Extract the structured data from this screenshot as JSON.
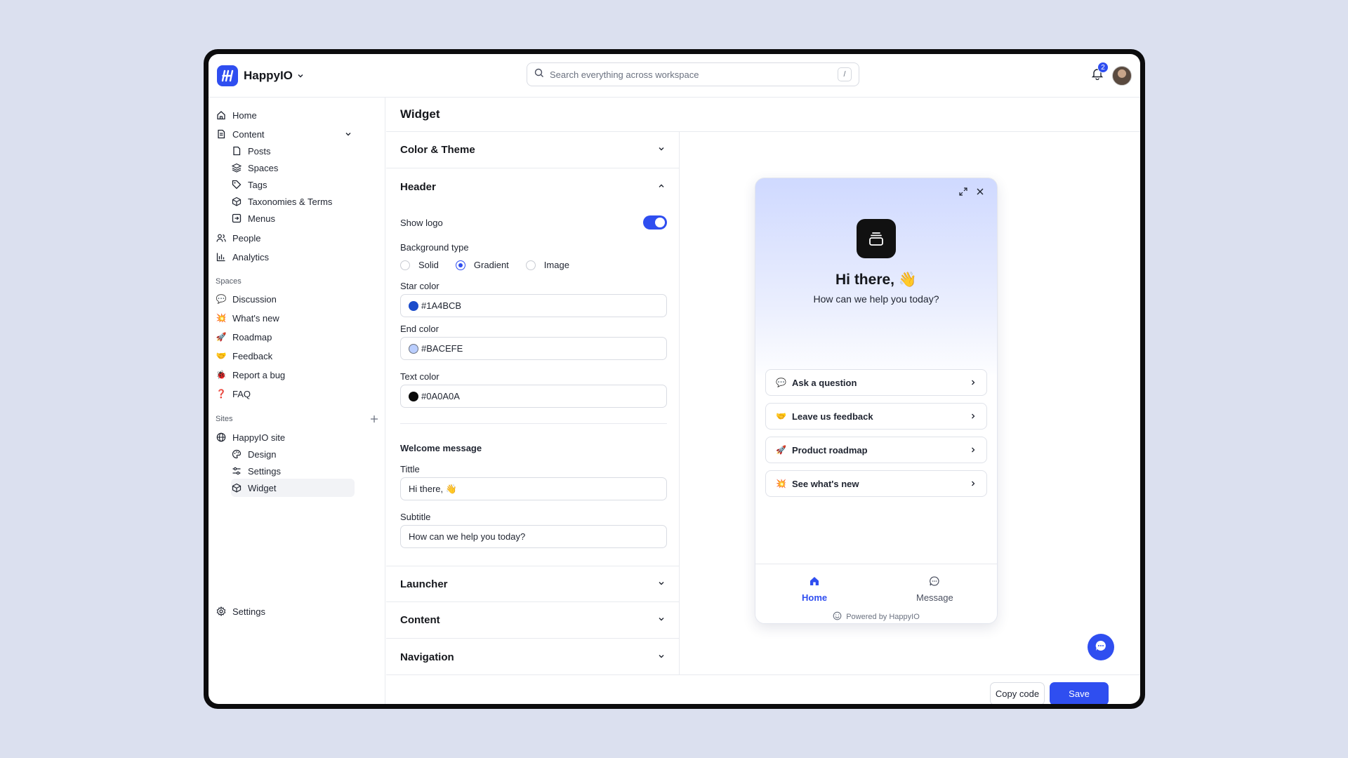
{
  "brand": {
    "name": "HappyIO"
  },
  "search": {
    "placeholder": "Search everything across workspace",
    "shortcut": "/"
  },
  "notifications": {
    "count": "2"
  },
  "sidebar": {
    "home": "Home",
    "content": "Content",
    "content_items": [
      "Posts",
      "Spaces",
      "Tags",
      "Taxonomies & Terms",
      "Menus"
    ],
    "people": "People",
    "analytics": "Analytics",
    "spaces_label": "Spaces",
    "spaces": [
      {
        "label": "Discussion",
        "emoji": "💬"
      },
      {
        "label": "What's new",
        "emoji": "💥"
      },
      {
        "label": "Roadmap",
        "emoji": "🚀"
      },
      {
        "label": "Feedback",
        "emoji": "🤝"
      },
      {
        "label": "Report a bug",
        "emoji": "🐞"
      },
      {
        "label": "FAQ",
        "emoji": "❓"
      }
    ],
    "sites_label": "Sites",
    "site": "HappyIO site",
    "site_items": [
      "Design",
      "Settings",
      "Widget"
    ],
    "settings": "Settings"
  },
  "page": {
    "title": "Widget"
  },
  "panel": {
    "color_theme": "Color & Theme",
    "header": "Header",
    "show_logo": "Show logo",
    "background_type": "Background type",
    "bg_options": [
      "Solid",
      "Gradient",
      "Image"
    ],
    "bg_selected": "Gradient",
    "star_color_label": "Star color",
    "star_color": "#1A4BCB",
    "end_color_label": "End color",
    "end_color": "#BACEFE",
    "text_color_label": "Text color",
    "text_color": "#0A0A0A",
    "welcome_message": "Welcome message",
    "title_label": "Tittle",
    "title_value": "Hi there, 👋",
    "subtitle_label": "Subtitle",
    "subtitle_value": "How can we help you today?",
    "launcher": "Launcher",
    "content": "Content",
    "navigation": "Navigation"
  },
  "widget": {
    "title": "Hi there, 👋",
    "subtitle": "How can we help you today?",
    "cards": [
      {
        "label": "Ask a question",
        "emoji": "💬"
      },
      {
        "label": "Leave us feedback",
        "emoji": "🤝"
      },
      {
        "label": "Product roadmap",
        "emoji": "🚀"
      },
      {
        "label": "See what's new",
        "emoji": "💥"
      }
    ],
    "tab_home": "Home",
    "tab_message": "Message",
    "powered": "Powered by HappyIO"
  },
  "footer": {
    "copy": "Copy code",
    "save": "Save"
  },
  "colors": {
    "accent": "#2F4EF0",
    "star": "#1A4BCB",
    "end": "#BACEFE",
    "text": "#0A0A0A"
  }
}
